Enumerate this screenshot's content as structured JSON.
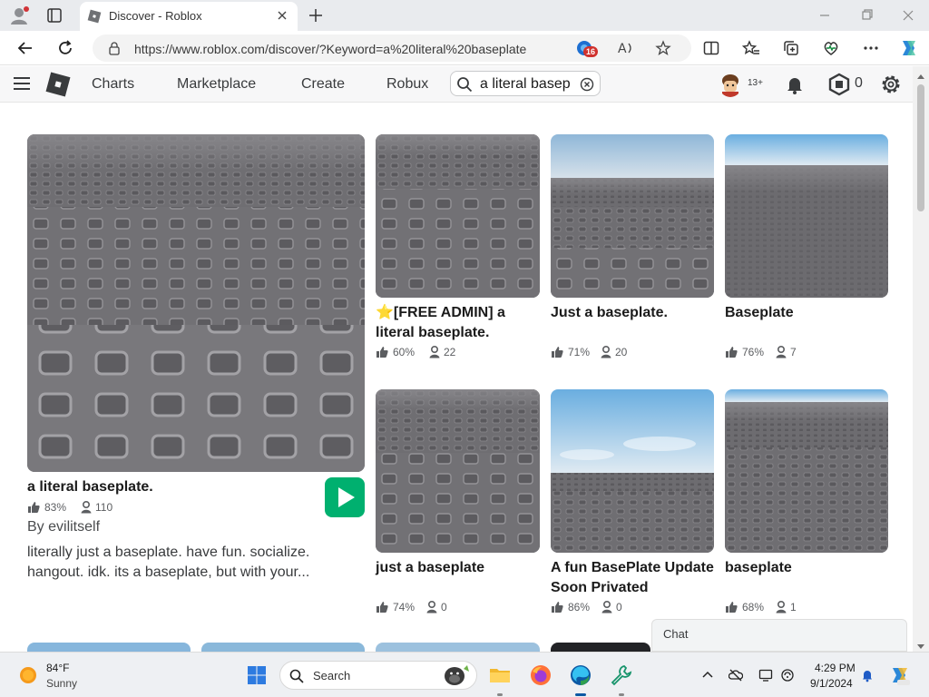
{
  "browser": {
    "tab_title": "Discover - Roblox",
    "url": "https://www.roblox.com/discover/?Keyword=a%20literal%20baseplate",
    "extension_badge": "16"
  },
  "header": {
    "nav": [
      "Charts",
      "Marketplace",
      "Create",
      "Robux"
    ],
    "search_value": "a literal baseplate",
    "age_badge": "13+",
    "robux_balance": "0"
  },
  "featured": {
    "title": "a literal baseplate.",
    "rating": "83%",
    "players": "110",
    "creator": "By evilitself",
    "description": "literally just a baseplate. have fun. socialize. hangout. idk. its a baseplate, but with your..."
  },
  "games": [
    {
      "title": "⭐[FREE ADMIN] a literal baseplate.",
      "rating": "60%",
      "players": "22"
    },
    {
      "title": "Just a baseplate.",
      "rating": "71%",
      "players": "20"
    },
    {
      "title": "Baseplate",
      "rating": "76%",
      "players": "7"
    },
    {
      "title": "just a baseplate",
      "rating": "74%",
      "players": "0"
    },
    {
      "title": "A fun BasePlate Update Soon Privated",
      "rating": "86%",
      "players": "0"
    },
    {
      "title": "baseplate",
      "rating": "68%",
      "players": "1"
    }
  ],
  "chat": {
    "label": "Chat"
  },
  "taskbar": {
    "temperature": "84°F",
    "condition": "Sunny",
    "search_label": "Search",
    "time": "4:29 PM",
    "date": "9/1/2024"
  },
  "colors": {
    "play_button": "#00b06f",
    "robux": "#393b3d",
    "accent_edge": "#0c59a4"
  }
}
